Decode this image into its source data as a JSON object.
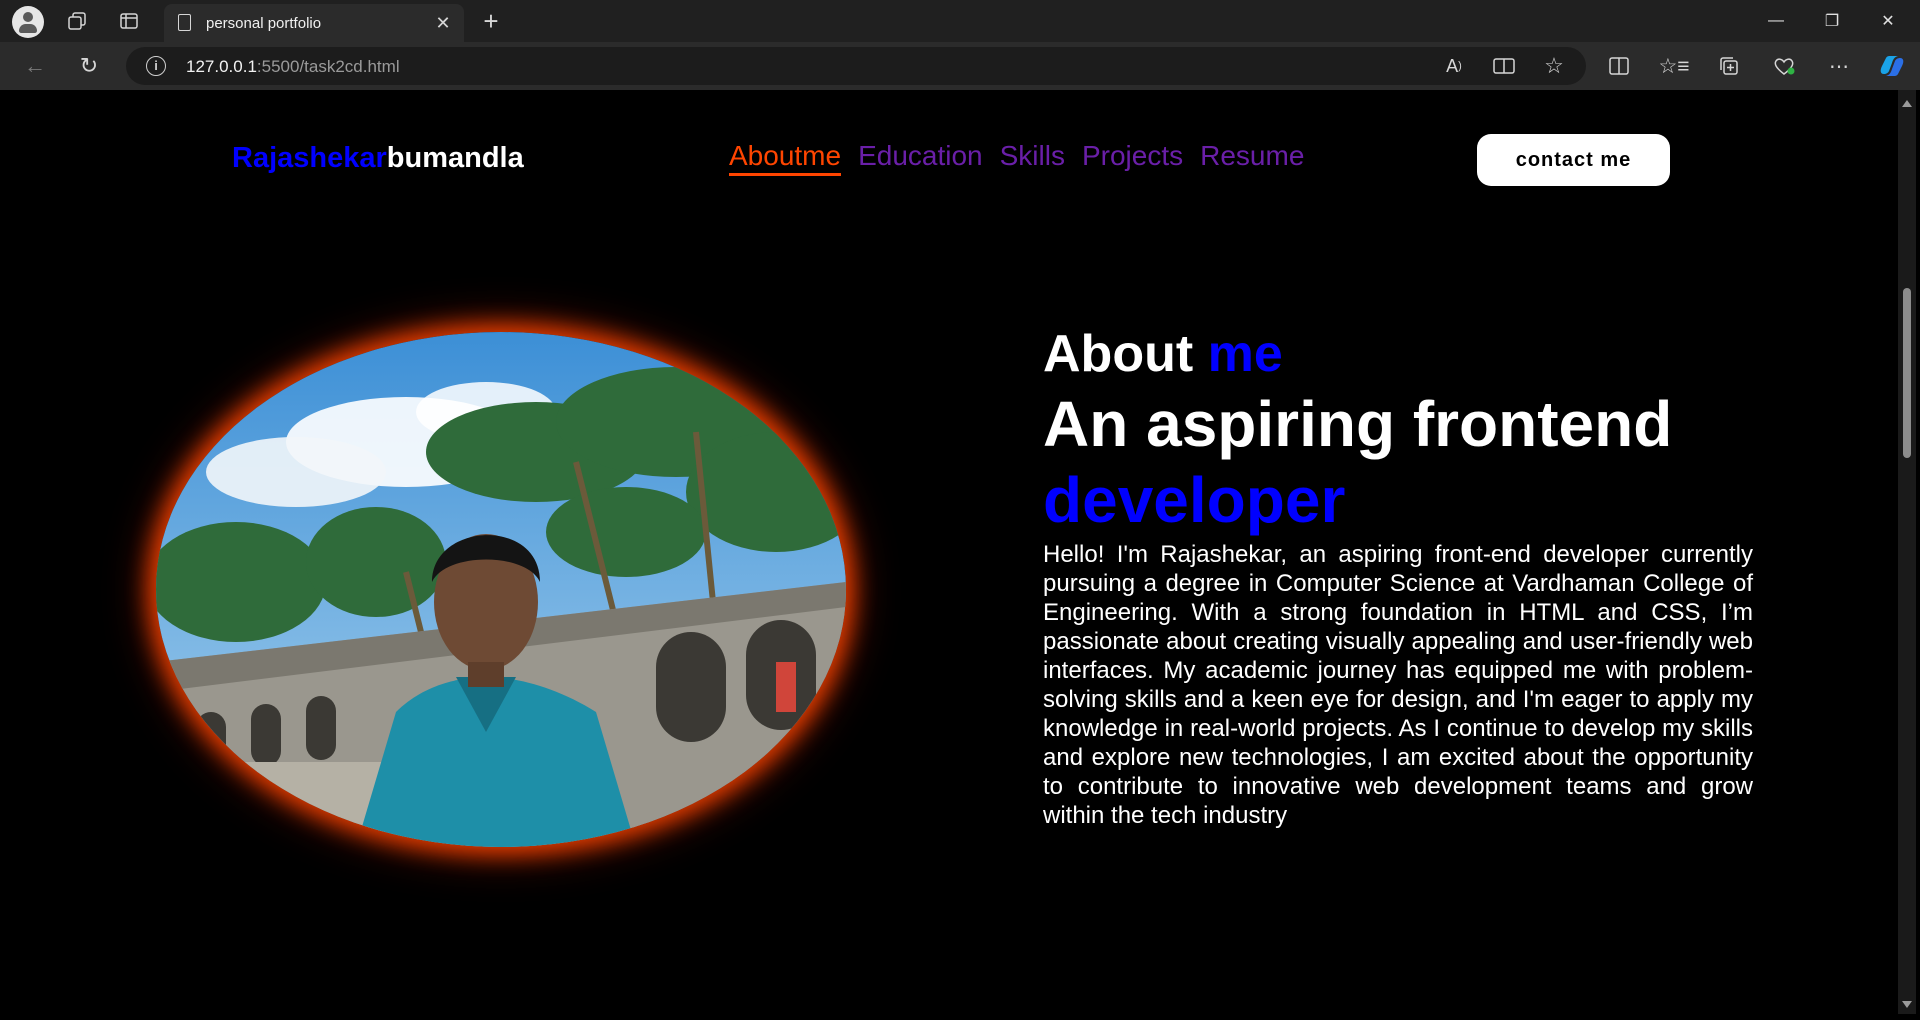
{
  "browser": {
    "tab_title": "personal portfolio",
    "url_host": "127.0.0.1",
    "url_rest": ":5500/task2cd.html"
  },
  "nav": {
    "logo_first": "Rajashekar",
    "logo_last": "bumandla",
    "links": [
      "Aboutme",
      "Education",
      "Skills",
      "Projects",
      "Resume"
    ],
    "active_link": "Aboutme",
    "contact_label": "contact me"
  },
  "about": {
    "title_main": "About ",
    "title_highlight": "me",
    "headline_main": "An aspiring frontend ",
    "headline_highlight": "developer",
    "bio": "Hello! I'm Rajashekar, an aspiring front-end developer currently pursuing a degree in Computer Science at Vardhaman College of Engineering. With a strong foundation in HTML and CSS, I’m passionate about creating visually appealing and user-friendly web interfaces. My academic journey has equipped me with problem-solving skills and a keen eye for design, and I'm eager to apply my knowledge in real-world projects. As I continue to develop my skills and explore new technologies, I am excited about the opportunity to contribute to innovative web development teams and grow within the tech industry"
  },
  "colors": {
    "accent_blue": "#0000ff",
    "nav_purple": "#6a1fa8",
    "active_orange": "#ff4500",
    "background": "#000000"
  },
  "icons": [
    "profile-icon",
    "workspaces-icon",
    "tab-actions-icon",
    "document-icon",
    "close-icon",
    "new-tab-icon",
    "back-icon",
    "refresh-icon",
    "info-icon",
    "read-aloud-icon",
    "immersive-reader-icon",
    "favorite-star-icon",
    "split-screen-icon",
    "favorites-icon",
    "collections-icon",
    "browser-essentials-icon",
    "more-icon",
    "copilot-icon"
  ]
}
